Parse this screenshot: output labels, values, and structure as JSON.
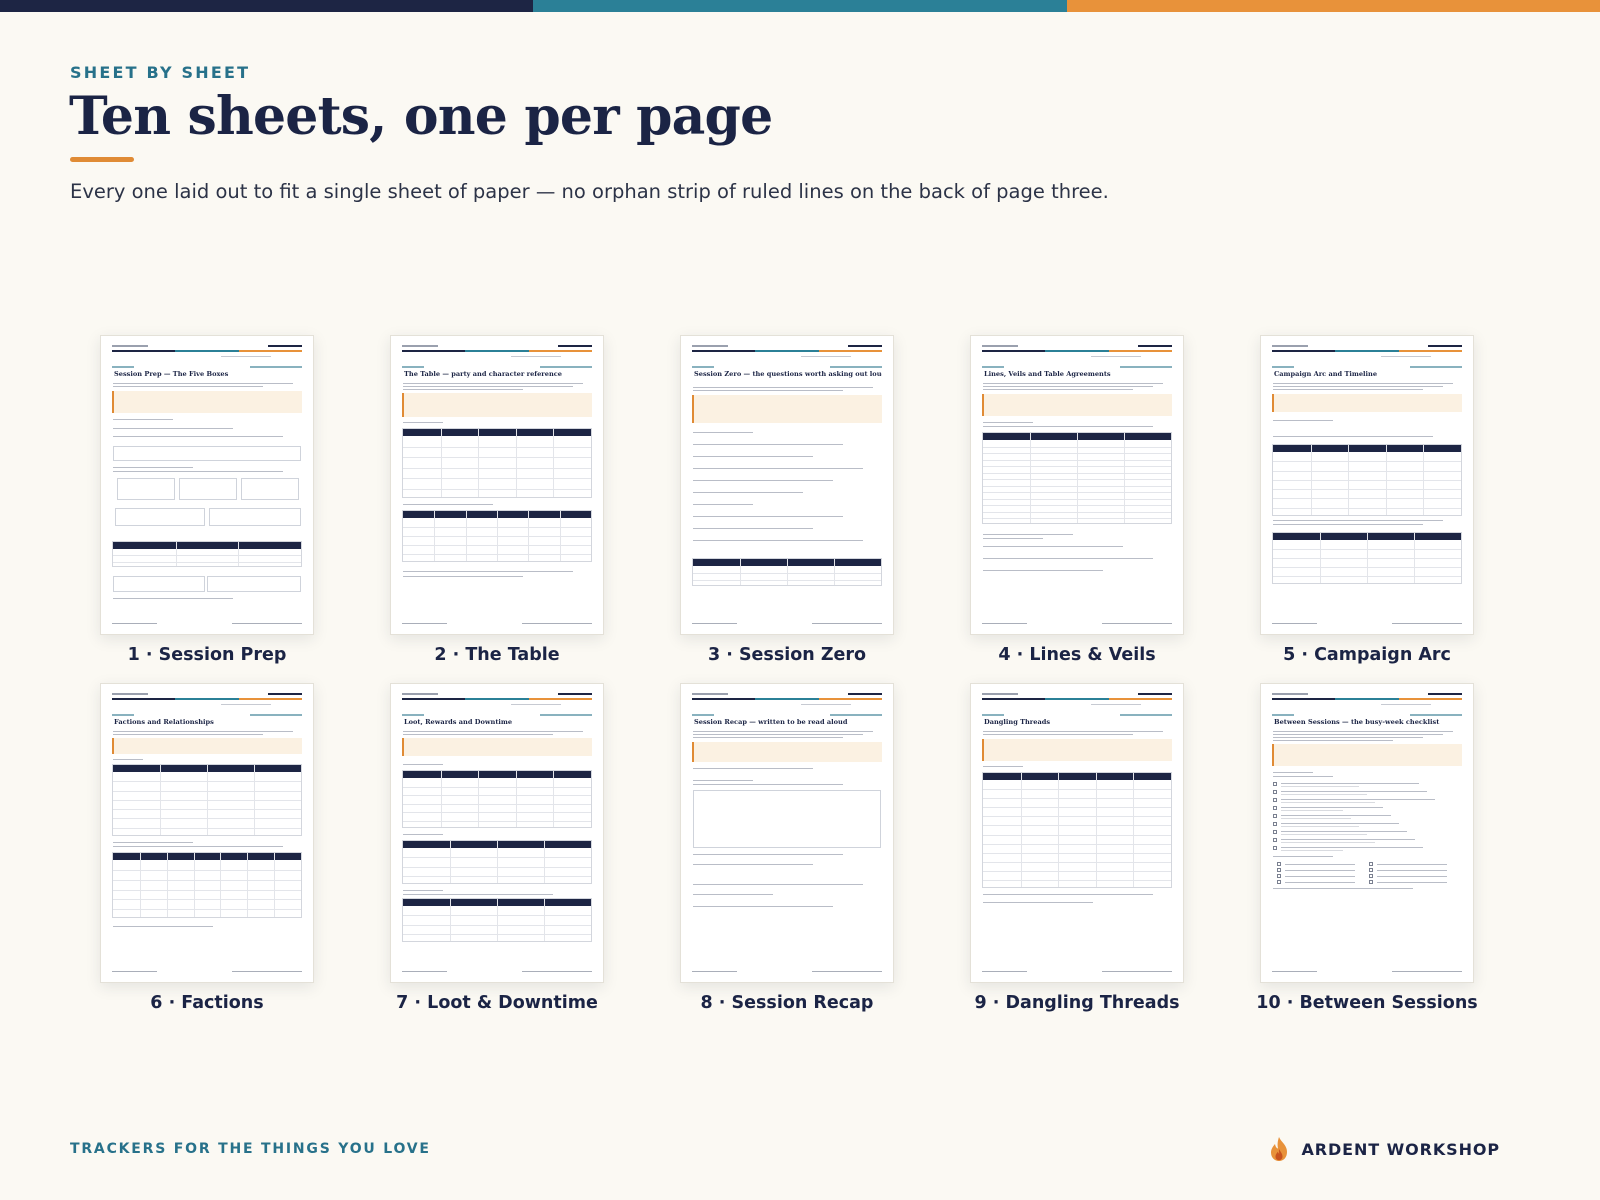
{
  "colors": {
    "navy": "#1d2544",
    "teal": "#2b8097",
    "orange": "#e8923a",
    "background": "#fbf9f3"
  },
  "header": {
    "eyebrow": "SHEET BY SHEET",
    "title": "Ten sheets, one per page",
    "subtitle": "Every one laid out to fit a single sheet of paper — no orphan strip of ruled lines on the back of page three."
  },
  "sheets": [
    {
      "caption": "1 · Session Prep",
      "page_title": "Session Prep — The Five Boxes",
      "layout": "prep"
    },
    {
      "caption": "2 · The Table",
      "page_title": "The Table — party and character reference",
      "layout": "table"
    },
    {
      "caption": "3 · Session Zero",
      "page_title": "Session Zero — the questions worth asking out loud",
      "layout": "zero"
    },
    {
      "caption": "4 · Lines & Veils",
      "page_title": "Lines, Veils and Table Agreements",
      "layout": "lines"
    },
    {
      "caption": "5 · Campaign Arc",
      "page_title": "Campaign Arc and Timeline",
      "layout": "arc"
    },
    {
      "caption": "6 · Factions",
      "page_title": "Factions and Relationships",
      "layout": "factions"
    },
    {
      "caption": "7 · Loot & Downtime",
      "page_title": "Loot, Rewards and Downtime",
      "layout": "loot"
    },
    {
      "caption": "8 · Session Recap",
      "page_title": "Session Recap — written to be read aloud",
      "layout": "recap"
    },
    {
      "caption": "9 · Dangling Threads",
      "page_title": "Dangling Threads",
      "layout": "threads"
    },
    {
      "caption": "10 · Between Sessions",
      "page_title": "Between Sessions — the busy-week checklist",
      "layout": "between"
    }
  ],
  "footer": {
    "tagline": "TRACKERS FOR THE THINGS YOU LOVE",
    "brand": "ARDENT WORKSHOP",
    "brand_icon": "flame-icon"
  }
}
